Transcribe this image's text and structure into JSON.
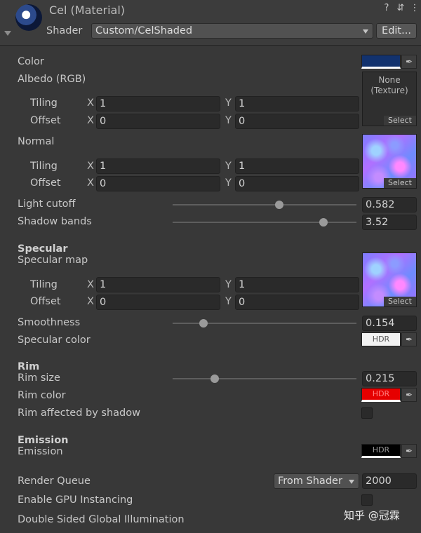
{
  "header": {
    "title": "Cel (Material)",
    "shader_label": "Shader",
    "shader_value": "Custom/CelShaded",
    "edit_button": "Edit...",
    "help_icon": "?",
    "settings_icon": "⇵",
    "more_icon": "⋮"
  },
  "tiling_label": "Tiling",
  "offset_label": "Offset",
  "x_label": "X",
  "y_label": "Y",
  "select_label": "Select",
  "hdr_label": "HDR",
  "color": {
    "label": "Color",
    "swatch_hex": "#12326e"
  },
  "albedo": {
    "label": "Albedo (RGB)",
    "slot_text_1": "None",
    "slot_text_2": "(Texture)",
    "tiling_x": "1",
    "tiling_y": "1",
    "offset_x": "0",
    "offset_y": "0"
  },
  "normal": {
    "label": "Normal",
    "tiling_x": "1",
    "tiling_y": "1",
    "offset_x": "0",
    "offset_y": "0"
  },
  "light_cutoff": {
    "label": "Light cutoff",
    "value": "0.582",
    "fraction": 0.582
  },
  "shadow_bands": {
    "label": "Shadow bands",
    "value": "3.52",
    "fraction": 0.82
  },
  "specular": {
    "section": "Specular",
    "map_label": "Specular map",
    "tiling_x": "1",
    "tiling_y": "1",
    "offset_x": "0",
    "offset_y": "0"
  },
  "smoothness": {
    "label": "Smoothness",
    "value": "0.154",
    "fraction": 0.168
  },
  "specular_color": {
    "label": "Specular color",
    "swatch_hex": "#f2f2f2"
  },
  "rim": {
    "section": "Rim",
    "size_label": "Rim size",
    "size_value": "0.215",
    "size_fraction": 0.23,
    "color_label": "Rim color",
    "color_hex": "#e60000",
    "shadow_label": "Rim affected by shadow"
  },
  "emission": {
    "section": "Emission",
    "label": "Emission",
    "swatch_hex": "#000000"
  },
  "render_queue": {
    "label": "Render Queue",
    "dropdown": "From Shader",
    "value": "2000"
  },
  "gpu_instancing": {
    "label": "Enable GPU Instancing"
  },
  "double_sided_gi": {
    "label": "Double Sided Global Illumination"
  },
  "watermark": "知乎 @冠霖"
}
